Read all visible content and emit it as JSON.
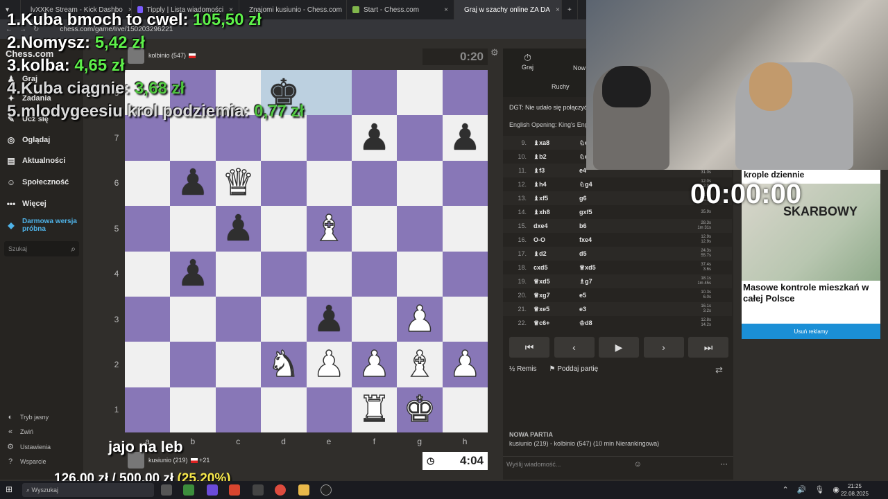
{
  "browser": {
    "tabs": [
      {
        "label": "lvXXKe Stream - Kick Dashbo",
        "color": "#53fc18"
      },
      {
        "label": "Tipply | Lista wiadomości",
        "color": "#7b5cff"
      },
      {
        "label": "Znajomi kusiunio - Chess.com",
        "color": "#81b64c"
      },
      {
        "label": "Start - Chess.com",
        "color": "#81b64c"
      },
      {
        "label": "Graj w szachy online ZA DA",
        "color": "#81b64c"
      }
    ],
    "close_glyph": "×",
    "new_tab_glyph": "+",
    "url": "chess.com/game/live/150203296221"
  },
  "sidebar": {
    "logo": "Chess.com",
    "items": [
      {
        "label": "Graj",
        "icon": "play-icon"
      },
      {
        "label": "Zadania",
        "icon": "puzzle-icon"
      },
      {
        "label": "Ucz się",
        "icon": "learn-icon"
      },
      {
        "label": "Oglądaj",
        "icon": "binoculars-icon"
      },
      {
        "label": "Aktualności",
        "icon": "news-icon"
      },
      {
        "label": "Społeczność",
        "icon": "community-icon"
      },
      {
        "label": "Więcej",
        "icon": "more-icon"
      }
    ],
    "trial": "Darmowa wersja próbna",
    "search_placeholder": "Szukaj",
    "bottom": [
      {
        "label": "Tryb jasny",
        "icon": "theme-icon"
      },
      {
        "label": "Zwiń",
        "icon": "collapse-icon"
      },
      {
        "label": "Ustawienia",
        "icon": "settings-icon"
      },
      {
        "label": "Wsparcie",
        "icon": "help-icon"
      }
    ]
  },
  "game": {
    "top_player": {
      "name": "kolbinio",
      "rating": "(547)",
      "clock": "0:20"
    },
    "bottom_player": {
      "name": "kusiunio",
      "rating": "(219)",
      "material": "+21",
      "clock": "4:04"
    },
    "ranks": [
      "8",
      "7",
      "6",
      "5",
      "4",
      "3",
      "2",
      "1"
    ],
    "files": [
      "a",
      "b",
      "c",
      "d",
      "e",
      "f",
      "g",
      "h"
    ],
    "position": [
      [
        "",
        "",
        "",
        "bk",
        "",
        "",
        "",
        ""
      ],
      [
        "",
        "",
        "",
        "",
        "",
        "bp",
        "",
        "bp"
      ],
      [
        "",
        "bp",
        "wq",
        "",
        "",
        "",
        "",
        ""
      ],
      [
        "",
        "",
        "bp",
        "",
        "wb",
        "",
        "",
        ""
      ],
      [
        "",
        "bp",
        "",
        "",
        "",
        "",
        "",
        ""
      ],
      [
        "",
        "",
        "",
        "",
        "bp",
        "",
        "wp",
        ""
      ],
      [
        "",
        "",
        "",
        "wn",
        "wp",
        "wp",
        "wb",
        "wp"
      ],
      [
        "",
        "",
        "",
        "",
        "",
        "wr",
        "wk",
        ""
      ]
    ],
    "highlight": [
      [
        0,
        3
      ],
      [
        0,
        4
      ]
    ]
  },
  "panel": {
    "tab_play": "Graj",
    "tab_new": "Now",
    "tab_moves": "Ruchy",
    "message": "DGT: Nie udało się połączyć do",
    "opening": "English Opening: King's Engli",
    "moves": [
      {
        "n": "9.",
        "w": "♝xa8",
        "b": "♘c6",
        "t1": "",
        "t2": ""
      },
      {
        "n": "10.",
        "w": "♝b2",
        "b": "♘d4",
        "t1": "",
        "t2": ""
      },
      {
        "n": "11.",
        "w": "♝f3",
        "b": "e4",
        "t1": "22.5s",
        "t2": "31.0s"
      },
      {
        "n": "12.",
        "w": "♝h4",
        "b": "♘g4",
        "t1": "12.0s",
        "t2": "2.9s"
      },
      {
        "n": "13.",
        "w": "♝xf5",
        "b": "g6",
        "t1": "11.8s",
        "t2": "45.8s"
      },
      {
        "n": "14.",
        "w": "♝xh8",
        "b": "gxf5",
        "t1": "35.9s",
        "t2": ""
      },
      {
        "n": "15.",
        "w": "dxe4",
        "b": "b6",
        "t1": "28.3s",
        "t2": "1m 31s"
      },
      {
        "n": "16.",
        "w": "O-O",
        "b": "fxe4",
        "t1": "12.9s",
        "t2": "12.9s"
      },
      {
        "n": "17.",
        "w": "♝d2",
        "b": "d5",
        "t1": "24.3s",
        "t2": "55.7s"
      },
      {
        "n": "18.",
        "w": "cxd5",
        "b": "♕xd5",
        "t1": "37.4s",
        "t2": "3.6s"
      },
      {
        "n": "19.",
        "w": "♕xd5",
        "b": "♗g7",
        "t1": "18.1s",
        "t2": "1m 45s"
      },
      {
        "n": "20.",
        "w": "♕xg7",
        "b": "e5",
        "t1": "10.3s",
        "t2": "6.0s"
      },
      {
        "n": "21.",
        "w": "♕xe5",
        "b": "e3",
        "t1": "16.1s",
        "t2": "3.2s"
      },
      {
        "n": "22.",
        "w": "♕c6+",
        "b": "♔d8",
        "t1": "12.8s",
        "t2": "14.2s"
      }
    ],
    "draw": "Remis",
    "resign": "Poddaj partię",
    "new_game_title": "NOWA PARTIA",
    "new_game_desc": "kusiunio (219) - kolbinio (547) (10 min Nierankingowa)",
    "chat_placeholder": "Wyślij wiadomość..."
  },
  "overlay": {
    "donors": [
      {
        "rank": "1.",
        "name": "Kuba bmoch to cwel:",
        "amount": "105,50 zł"
      },
      {
        "rank": "2.",
        "name": "Nomysz:",
        "amount": "5,42 zł"
      },
      {
        "rank": "3.",
        "name": "kolba:",
        "amount": "4,65 zł"
      },
      {
        "rank": "4.",
        "name": "Kuba ciągnie:",
        "amount": "3,68 zł"
      },
      {
        "rank": "5.",
        "name": "mlodygeesiu krol podziemia:",
        "amount": "0,77 zł"
      }
    ],
    "caption": "jajo na leb",
    "goal": "126,00 zł / 500,00 zł",
    "goal_pct": "(25.20%)",
    "stream_timer": "00:00:00"
  },
  "ad": {
    "top": "krople dziennie",
    "brand": "SKARBOWY",
    "headline": "Masowe kontrole mieszkań w całej Polsce",
    "remove": "Usuń reklamy"
  },
  "taskbar": {
    "search": "Wyszukaj",
    "time": "21:25",
    "date": "22.08.2025"
  }
}
